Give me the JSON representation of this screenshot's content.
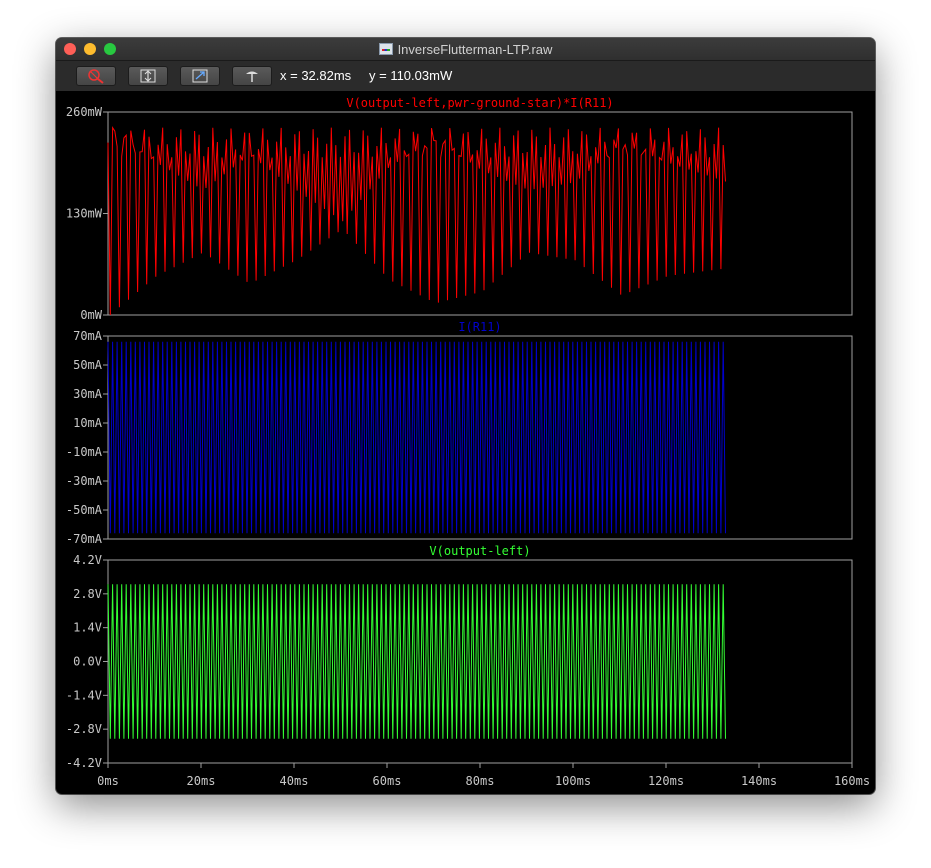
{
  "window": {
    "title": "InverseFlutterman-LTP.raw"
  },
  "toolbar": {
    "buttons": [
      {
        "icon": "zoom-cancel-icon"
      },
      {
        "icon": "autorange-icon"
      },
      {
        "icon": "zoom-back-icon"
      },
      {
        "icon": "pick-trace-icon"
      }
    ],
    "cursor_x": "x = 32.82ms",
    "cursor_y": "y = 110.03mW"
  },
  "colors": {
    "power": "#ff0000",
    "current": "#0000cc",
    "voltage": "#33ff33",
    "frame": "#a0a0a0",
    "axis_text": "#c8c8c8"
  },
  "chart_data": [
    {
      "type": "line",
      "title": "V(output-left,pwr-ground-star)*I(R11)",
      "series": [
        {
          "name": "V(output-left,pwr-ground-star)*I(R11)",
          "x_range": [
            0,
            132.8
          ],
          "y_min": 0,
          "y_max": 240,
          "envelope_mid": [
            [
              0,
              240
            ],
            [
              10,
              195
            ],
            [
              20,
              160
            ],
            [
              30,
              205
            ],
            [
              40,
              160
            ],
            [
              50,
              120
            ],
            [
              60,
              190
            ],
            [
              70,
              225
            ],
            [
              80,
              185
            ],
            [
              90,
              160
            ],
            [
              100,
              170
            ],
            [
              110,
              220
            ],
            [
              120,
              195
            ],
            [
              132.8,
              170
            ]
          ],
          "envelope_low": [
            [
              0,
              0
            ],
            [
              10,
              50
            ],
            [
              20,
              80
            ],
            [
              30,
              40
            ],
            [
              40,
              70
            ],
            [
              50,
              110
            ],
            [
              60,
              45
            ],
            [
              70,
              15
            ],
            [
              80,
              30
            ],
            [
              90,
              80
            ],
            [
              100,
              70
            ],
            [
              110,
              25
            ],
            [
              120,
              50
            ],
            [
              132.8,
              60
            ]
          ]
        }
      ],
      "x_ticks": [
        "0ms",
        "20ms",
        "40ms",
        "60ms",
        "80ms",
        "100ms",
        "120ms",
        "140ms",
        "160ms"
      ],
      "y_ticks": [
        "260mW",
        "130mW",
        "0mW"
      ],
      "ylim": [
        0,
        260
      ],
      "xlim": [
        0,
        160
      ]
    },
    {
      "type": "line",
      "title": "I(R11)",
      "series": [
        {
          "name": "I(R11)",
          "x_range": [
            0,
            132.8
          ],
          "amplitude": 66,
          "offset": 0
        }
      ],
      "y_ticks": [
        "70mA",
        "50mA",
        "30mA",
        "10mA",
        "-10mA",
        "-30mA",
        "-50mA",
        "-70mA"
      ],
      "ylim": [
        -70,
        70
      ],
      "xlim": [
        0,
        160
      ]
    },
    {
      "type": "line",
      "title": "V(output-left)",
      "series": [
        {
          "name": "V(output-left)",
          "x_range": [
            0,
            132.8
          ],
          "amplitude": 3.2,
          "offset": 0
        }
      ],
      "y_ticks": [
        "4.2V",
        "2.8V",
        "1.4V",
        "0.0V",
        "-1.4V",
        "-2.8V",
        "-4.2V"
      ],
      "ylim": [
        -4.2,
        4.2
      ],
      "xlim": [
        0,
        160
      ]
    }
  ]
}
